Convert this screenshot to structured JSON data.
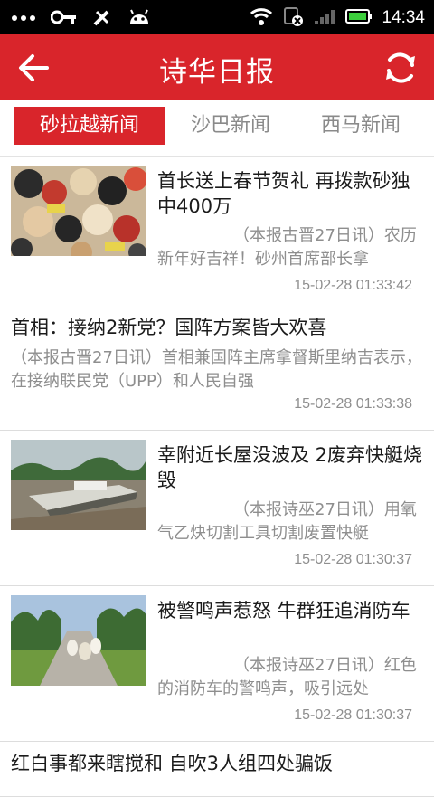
{
  "status_bar": {
    "time": "14:34"
  },
  "app_bar": {
    "title": "诗华日报"
  },
  "tabs": [
    {
      "label": "砂拉越新闻",
      "active": true
    },
    {
      "label": "沙巴新闻",
      "active": false
    },
    {
      "label": "西马新闻",
      "active": false
    }
  ],
  "articles": [
    {
      "title": "首长送上春节贺礼 再拨款砂独中400万",
      "summary": "（本报古晋27日讯）农历新年好吉祥！砂州首席部长拿",
      "time": "15-02-28 01:33:42",
      "image": "festival-crowd-photo"
    },
    {
      "title": "首相：接纳2新党？国阵方案皆大欢喜",
      "summary": "（本报古晋27日讯）首相兼国阵主席拿督斯里纳吉表示，在接纳联民党（UPP）和人民自强",
      "time": "15-02-28 01:33:38"
    },
    {
      "title": "幸附近长屋没波及 2废弃快艇烧毁",
      "summary": "（本报诗巫27日讯）用氧气乙炔切割工具切割废置快艇",
      "time": "15-02-28 01:30:37",
      "image": "boats-riverbank-photo"
    },
    {
      "title": "被警鸣声惹怒 牛群狂追消防车",
      "summary": "（本报诗巫27日讯）红色的消防车的警鸣声，吸引远处",
      "time": "15-02-28 01:30:37",
      "image": "cattle-road-photo"
    },
    {
      "title": "红白事都来瞎搅和 自吹3人组四处骗饭"
    }
  ],
  "colors": {
    "brand_red": "#d9252b",
    "status_bar": "#000000",
    "background": "#efefef"
  }
}
